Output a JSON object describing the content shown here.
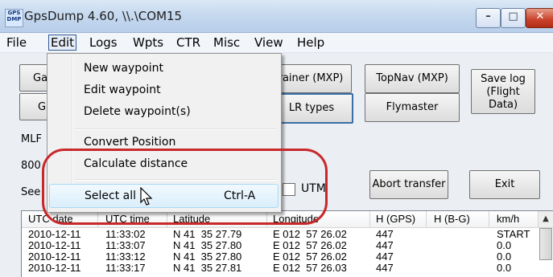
{
  "window": {
    "icon_text": "GPS DMP",
    "title": "GpsDump 4.60, \\\\.\\COM15",
    "minimize_glyph": "–",
    "maximize_glyph": "□",
    "close_glyph": "✕"
  },
  "menubar": {
    "items": [
      "File",
      "Edit",
      "Logs",
      "Wpts",
      "CTR",
      "Misc",
      "View",
      "Help"
    ],
    "active": "Edit"
  },
  "buttons": {
    "left_row1": "Ga",
    "left_row2": "G",
    "trainer": "rainer (MXP)",
    "topnav": "TopNav (MXP)",
    "save_log_line1": "Save log",
    "save_log_line2": "(Flight Data)",
    "mlr_types": "LR types",
    "flymaster": "Flymaster",
    "abort": "Abort transfer",
    "exit": "Exit"
  },
  "labels": {
    "mlf": "MLF",
    "num": "800",
    "see": "See",
    "utm": "UTM"
  },
  "edit_menu": {
    "items": [
      {
        "label": "New waypoint",
        "shortcut": ""
      },
      {
        "label": "Edit waypoint",
        "shortcut": ""
      },
      {
        "label": "Delete waypoint(s)",
        "shortcut": ""
      },
      {
        "label": "Convert Position",
        "shortcut": ""
      },
      {
        "label": "Calculate distance",
        "shortcut": ""
      },
      {
        "label": "Select all",
        "shortcut": "Ctrl-A"
      }
    ]
  },
  "track_table": {
    "columns": [
      "UTC date",
      "UTC time",
      "Latitude",
      "Longitude",
      "H (GPS)",
      "H (B-G)",
      "km/h"
    ],
    "rows": [
      [
        "2010-12-11",
        "11:33:02",
        "N 41  35 27.79",
        "E 012  57 26.02",
        "447",
        "",
        "START"
      ],
      [
        "2010-12-11",
        "11:33:07",
        "N 41  35 27.80",
        "E 012  57 26.02",
        "447",
        "",
        "0.0"
      ],
      [
        "2010-12-11",
        "11:33:12",
        "N 41  35 27.80",
        "E 012  57 26.02",
        "447",
        "",
        "0.0"
      ],
      [
        "2010-12-11",
        "11:33:17",
        "N 41  35 27.81",
        "E 012  57 26.03",
        "447",
        "",
        "0.0"
      ]
    ]
  },
  "colors": {
    "annotation_ring": "#c8282a",
    "menu_highlight": "#daeefb"
  }
}
